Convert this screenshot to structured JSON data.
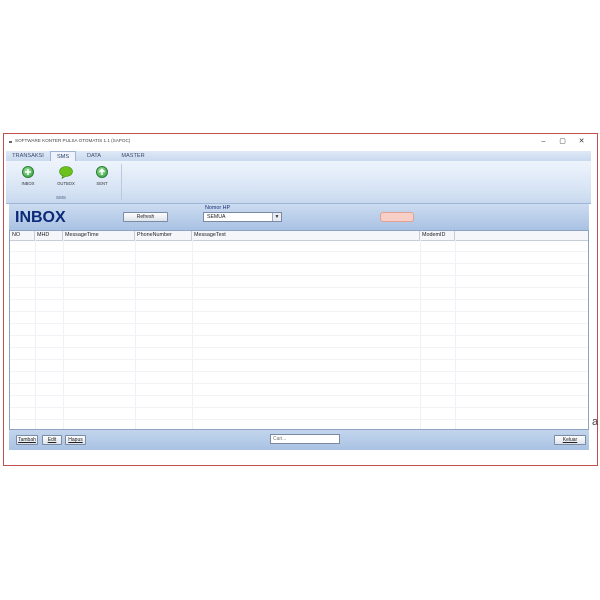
{
  "window": {
    "title": "SOFTWARE KONTER PULSA OTOMATIS 1.1 (SAPOC)",
    "controls": {
      "minimize": "–",
      "maximize": "▢",
      "close": "✕"
    }
  },
  "ribbon": {
    "tabs": [
      {
        "label": "TRANSAKSI",
        "active": false
      },
      {
        "label": "SMS",
        "active": true
      },
      {
        "label": "DATA",
        "active": false
      },
      {
        "label": "MASTER",
        "active": false
      }
    ],
    "buttons": [
      {
        "label": "INBOX",
        "icon": "plus-circle-icon",
        "color": "#3bb24a"
      },
      {
        "label": "OUTBOX",
        "icon": "speech-bubble-icon",
        "color": "#6cc21b"
      },
      {
        "label": "SENT",
        "icon": "up-arrow-circle-icon",
        "color": "#3bb24a"
      }
    ],
    "group_label": "SMS"
  },
  "header": {
    "title": "INBOX",
    "refresh_label": "Refresh",
    "nomor_label": "Nomor HP",
    "nomor_value": "SEMUA",
    "pink_button_color": "#f8cfc7"
  },
  "table": {
    "columns": [
      "NO",
      "MHD",
      "MessageTime",
      "PhoneNumber",
      "MessageText",
      "ModemID"
    ],
    "rows": []
  },
  "footer": {
    "tambah_label": "Tambah",
    "edit_label": "Edit",
    "hapus_label": "Hapus",
    "search_placeholder": "Cari...",
    "keluar_label": "Keluar"
  },
  "colors": {
    "title_blue": "#0c2a78",
    "band_blue": "#a9c2e3",
    "window_border": "#c0504d"
  },
  "edge_char": "a"
}
